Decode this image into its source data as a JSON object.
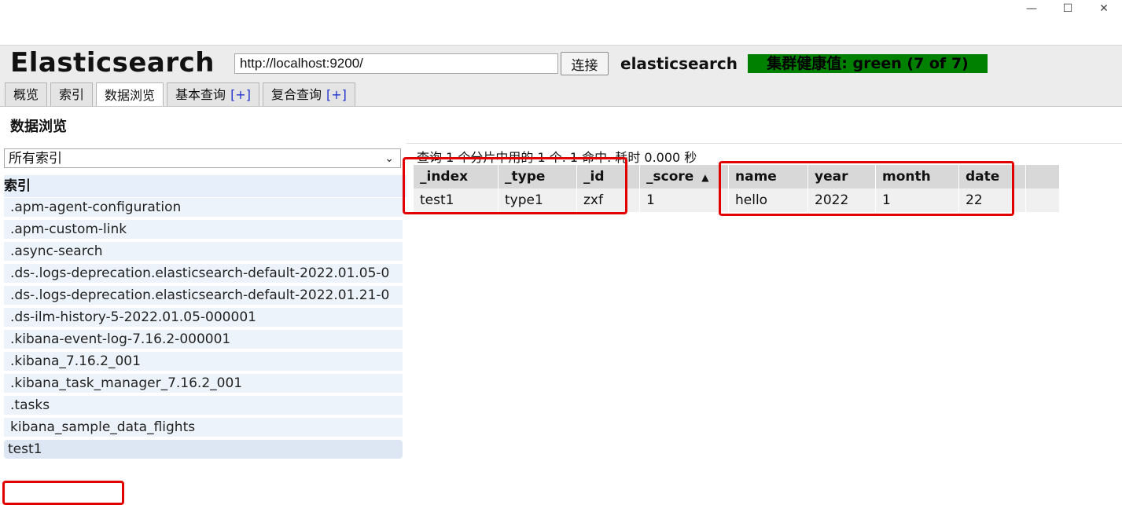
{
  "window": {
    "minimize": "—",
    "maximize": "☐",
    "close": "✕"
  },
  "header": {
    "brand": "Elasticsearch",
    "url": "http://localhost:9200/",
    "connect_label": "连接",
    "cluster_name": "elasticsearch",
    "health": "集群健康值: green (7 of 7)",
    "health_color": "#008000"
  },
  "tabs": [
    {
      "label": "概览"
    },
    {
      "label": "索引"
    },
    {
      "label": "数据浏览",
      "active": true
    },
    {
      "label": "基本查询",
      "plus": "[+]"
    },
    {
      "label": "复合查询",
      "plus": "[+]"
    }
  ],
  "page_title": "数据浏览",
  "sidebar": {
    "select_value": "所有索引",
    "section_title": "索引",
    "items": [
      ".apm-agent-configuration",
      ".apm-custom-link",
      ".async-search",
      ".ds-.logs-deprecation.elasticsearch-default-2022.01.05-0",
      ".ds-.logs-deprecation.elasticsearch-default-2022.01.21-0",
      ".ds-ilm-history-5-2022.01.05-000001",
      ".kibana-event-log-7.16.2-000001",
      ".kibana_7.16.2_001",
      ".kibana_task_manager_7.16.2_001",
      ".tasks",
      "kibana_sample_data_flights",
      "test1"
    ]
  },
  "results": {
    "summary": "查询 1 个分片中用的 1 个. 1 命中. 耗时 0.000 秒",
    "columns": [
      "_index",
      "_type",
      "_id",
      "_score",
      "name",
      "year",
      "month",
      "date"
    ],
    "sort_indicator": "▲",
    "rows": [
      [
        "test1",
        "type1",
        "zxf",
        "1",
        "hello",
        "2022",
        "1",
        "22"
      ]
    ]
  },
  "highlight_color": "#e00000"
}
